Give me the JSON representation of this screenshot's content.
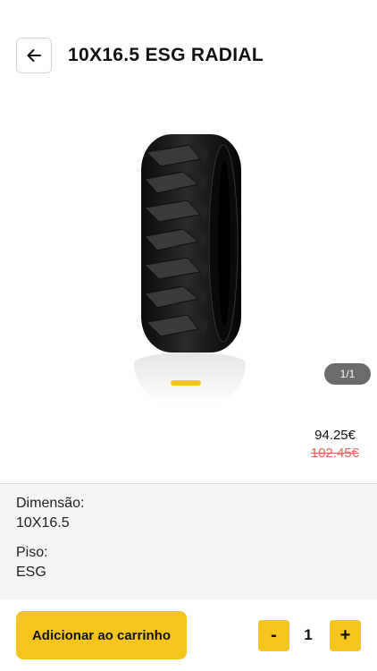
{
  "header": {
    "back_icon": "arrow-left-icon",
    "title": "10X16.5 ESG RADIAL"
  },
  "gallery": {
    "image_icon": "tire-image",
    "counter": "1/1",
    "accent": "#f5c51c"
  },
  "pricing": {
    "price": "94.25€",
    "old_price": "102.45€",
    "old_price_color": "#e0645a"
  },
  "specs": [
    {
      "label": "Dimensão:",
      "value": "10X16.5"
    },
    {
      "label": "Piso:",
      "value": "ESG"
    }
  ],
  "footer": {
    "cart_label": "Adicionar ao carrinho",
    "minus_label": "-",
    "quantity": "1",
    "plus_label": "+"
  }
}
